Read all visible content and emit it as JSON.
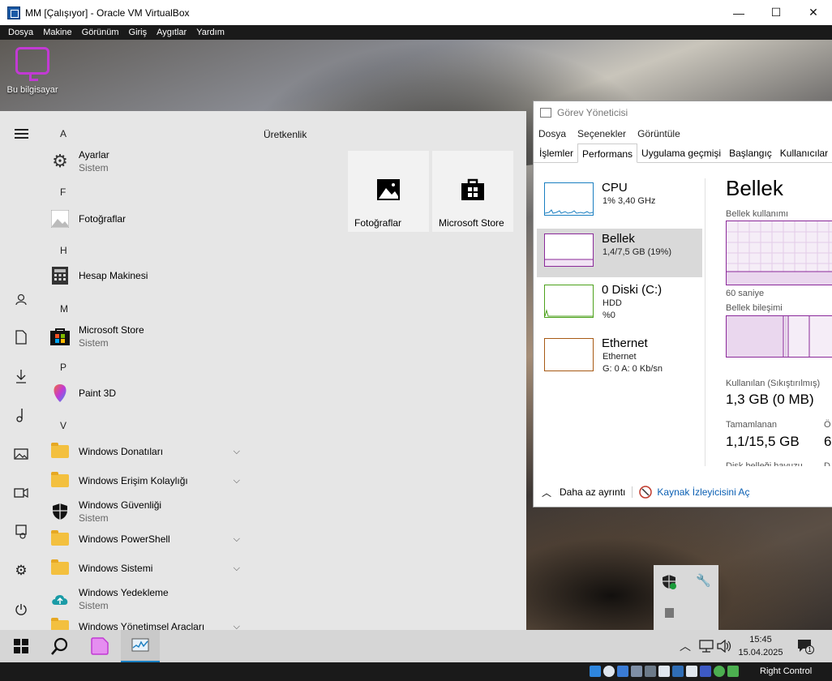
{
  "window": {
    "title": "MM [Çalışıyor] - Oracle VM VirtualBox",
    "minimize": "—",
    "maximize": "☐",
    "close": "✕"
  },
  "menubar": [
    "Dosya",
    "Makine",
    "Görünüm",
    "Giriş",
    "Aygıtlar",
    "Yardım"
  ],
  "desktop": {
    "icon_label": "Bu bilgisayar",
    "icon_color": "#c23ad4"
  },
  "start_menu": {
    "letters": [
      "A",
      "F",
      "H",
      "M",
      "P",
      "V"
    ],
    "apps": [
      {
        "name": "Ayarlar",
        "sub": "Sistem",
        "icon": "gear-icon"
      },
      {
        "name": "Fotoğraflar",
        "sub": "",
        "icon": "photos-icon"
      },
      {
        "name": "Hesap Makinesi",
        "sub": "",
        "icon": "calculator-icon"
      },
      {
        "name": "Microsoft Store",
        "sub": "Sistem",
        "icon": "store-icon"
      },
      {
        "name": "Paint 3D",
        "sub": "",
        "icon": "paint3d-icon"
      },
      {
        "name": "Windows Donatıları",
        "sub": "",
        "icon": "folder-icon",
        "expandable": true
      },
      {
        "name": "Windows Erişim Kolaylığı",
        "sub": "",
        "icon": "folder-icon",
        "expandable": true
      },
      {
        "name": "Windows Güvenliği",
        "sub": "Sistem",
        "icon": "shield-icon"
      },
      {
        "name": "Windows PowerShell",
        "sub": "",
        "icon": "folder-icon",
        "expandable": true
      },
      {
        "name": "Windows Sistemi",
        "sub": "",
        "icon": "folder-icon",
        "expandable": true
      },
      {
        "name": "Windows Yedekleme",
        "sub": "Sistem",
        "icon": "backup-icon"
      },
      {
        "name": "Windows Yönetimsel Araçları",
        "sub": "",
        "icon": "folder-icon",
        "expandable": true
      }
    ],
    "tiles_group": "Üretkenlik",
    "tiles": [
      {
        "label": "Fotoğraflar",
        "icon": "photos-icon"
      },
      {
        "label": "Microsoft Store",
        "icon": "store-icon"
      }
    ]
  },
  "task_manager": {
    "title": "Görev Yöneticisi",
    "menu": [
      "Dosya",
      "Seçenekler",
      "Görüntüle"
    ],
    "tabs": [
      "İşlemler",
      "Performans",
      "Uygulama geçmişi",
      "Başlangıç",
      "Kullanıcılar"
    ],
    "active_tab": "Performans",
    "resources": [
      {
        "name": "CPU",
        "line1": "1% 3,40 GHz",
        "line2": "",
        "color": "#1a7fc1"
      },
      {
        "name": "Bellek",
        "line1": "1,4/7,5 GB (19%)",
        "line2": "",
        "color": "#8b2a9a"
      },
      {
        "name": "0 Diski (C:)",
        "line1": "HDD",
        "line2": "%0",
        "color": "#4da21c"
      },
      {
        "name": "Ethernet",
        "line1": "Ethernet",
        "line2": "G: 0 A: 0 Kb/sn",
        "color": "#a75a14"
      }
    ],
    "detail": {
      "heading": "Bellek",
      "usage_label": "Bellek kullanımı",
      "time_label": "60 saniye",
      "composition_label": "Bellek bileşimi",
      "in_use_label": "Kullanılan (Sıkıştırılmış)",
      "in_use_value": "1,3 GB (0 MB)",
      "committed_label": "Tamamlanan",
      "committed_value": "1,1/15,5 GB",
      "available_label_cut": "Ö",
      "available_value_cut": "6",
      "cutoff_label": "Disk belleği havuzu",
      "cutoff_label2": "D"
    },
    "footer": {
      "fewer_details": "Daha az ayrıntı",
      "resource_monitor": "Kaynak İzleyicisini Aç"
    }
  },
  "taskbar": {
    "clock_time": "15:45",
    "clock_date": "15.04.2025",
    "notification_count": "1"
  },
  "vb_status": {
    "host_key": "Right Control"
  }
}
